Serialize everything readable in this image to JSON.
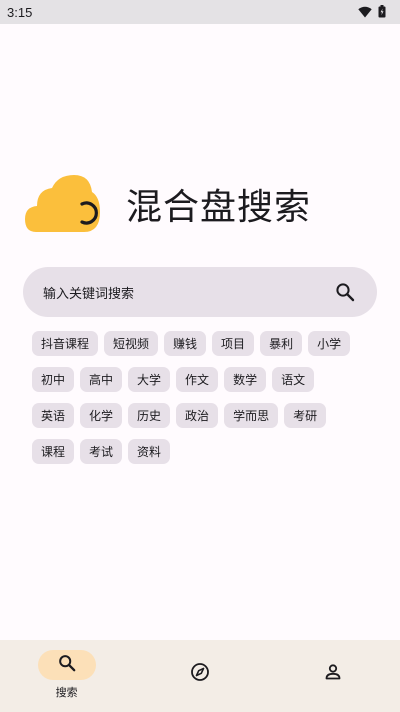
{
  "status_bar": {
    "time": "3:15",
    "icons": [
      "wifi-icon",
      "battery-icon"
    ]
  },
  "app": {
    "title": "混合盘搜索",
    "logo": "cloud-logo",
    "colors": {
      "logo_yellow": "#fbbf3c",
      "background": "#fffbfe",
      "chip": "#e7e0e8",
      "nav_bg": "#f3ede6",
      "nav_active": "#fce0b8"
    }
  },
  "search": {
    "placeholder": "输入关键词搜索",
    "icon": "search-icon"
  },
  "tags": [
    "抖音课程",
    "短视频",
    "赚钱",
    "项目",
    "暴利",
    "小学",
    "初中",
    "高中",
    "大学",
    "作文",
    "数学",
    "语文",
    "英语",
    "化学",
    "历史",
    "政治",
    "学而思",
    "考研",
    "课程",
    "考试",
    "资料"
  ],
  "bottom_nav": {
    "items": [
      {
        "icon": "search-icon",
        "label": "搜索",
        "active": true
      },
      {
        "icon": "compass-icon",
        "label": "",
        "active": false
      },
      {
        "icon": "person-icon",
        "label": "",
        "active": false
      }
    ]
  }
}
